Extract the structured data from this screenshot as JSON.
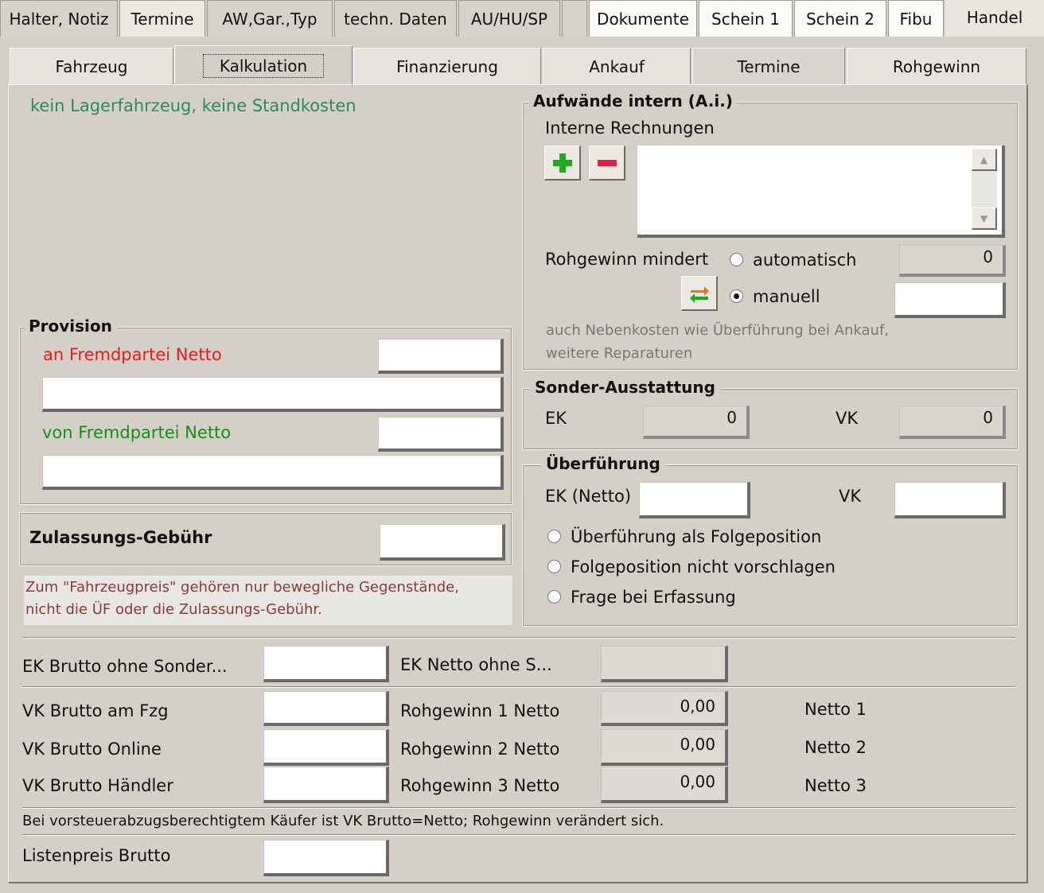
{
  "top_tabs": [
    "Halter, Notiz",
    "Termine",
    "AW,Gar.,Typ",
    "techn. Daten",
    "AU/HU/SP",
    "",
    "Dokumente",
    "Schein 1",
    "Schein 2",
    "Fibu",
    "Handel"
  ],
  "sub_tabs": [
    "Fahrzeug",
    "Kalkulation",
    "Finanzierung",
    "Ankauf",
    "Termine",
    "Rohgewinn"
  ],
  "status_text": "kein Lagerfahrzeug, keine Standkosten",
  "aufwaende": {
    "title": "Aufwände intern (A.i.)",
    "internal_invoices_label": "Interne Rechnungen",
    "reduces_label": "Rohgewinn mindert",
    "radio_auto": "automatisch",
    "radio_manual": "manuell",
    "auto_value": "0",
    "manual_value": "",
    "note_line1": "auch Nebenkosten wie Überführung bei Ankauf,",
    "note_line2": "weitere Reparaturen"
  },
  "provision": {
    "title": "Provision",
    "to_third": "an Fremdpartei Netto",
    "from_third": "von Fremdpartei Netto"
  },
  "zulassung_label": "Zulassungs-Gebühr",
  "fahrzeugpreis_note_line1": "Zum \"Fahrzeugpreis\" gehören nur bewegliche Gegenstände,",
  "fahrzeugpreis_note_line2": "nicht die ÜF oder die Zulassungs-Gebühr.",
  "sonder": {
    "title": "Sonder-Ausstattung",
    "ek_label": "EK",
    "ek_value": "0",
    "vk_label": "VK",
    "vk_value": "0"
  },
  "ueberfuehrung": {
    "title": "Überführung",
    "ek_label": "EK (Netto)",
    "vk_label": "VK",
    "options": [
      "Überführung als Folgeposition",
      "Folgeposition nicht vorschlagen",
      "Frage bei Erfassung"
    ]
  },
  "bottom": {
    "ek_brutto_label": "EK Brutto ohne Sonder...",
    "ek_netto_label": "EK Netto ohne S...",
    "vk_fzg_label": "VK Brutto am Fzg",
    "vk_online_label": "VK Brutto Online",
    "vk_haendler_label": "VK Brutto Händler",
    "rg1_label": "Rohgewinn 1 Netto",
    "rg2_label": "Rohgewinn 2 Netto",
    "rg3_label": "Rohgewinn 3 Netto",
    "rg1_value": "0,00",
    "rg2_value": "0,00",
    "rg3_value": "0,00",
    "netto1": "Netto 1",
    "netto2": "Netto 2",
    "netto3": "Netto 3",
    "hint": "Bei vorsteuerabzugsberechtigtem Käufer ist VK Brutto=Netto; Rohgewinn verändert sich.",
    "listenpreis_label": "Listenpreis Brutto"
  },
  "colors": {
    "status_green": "#2e8b57",
    "red_label": "#e02020",
    "green_label": "#1a8a1a",
    "note_brown": "#8b3a3a"
  }
}
